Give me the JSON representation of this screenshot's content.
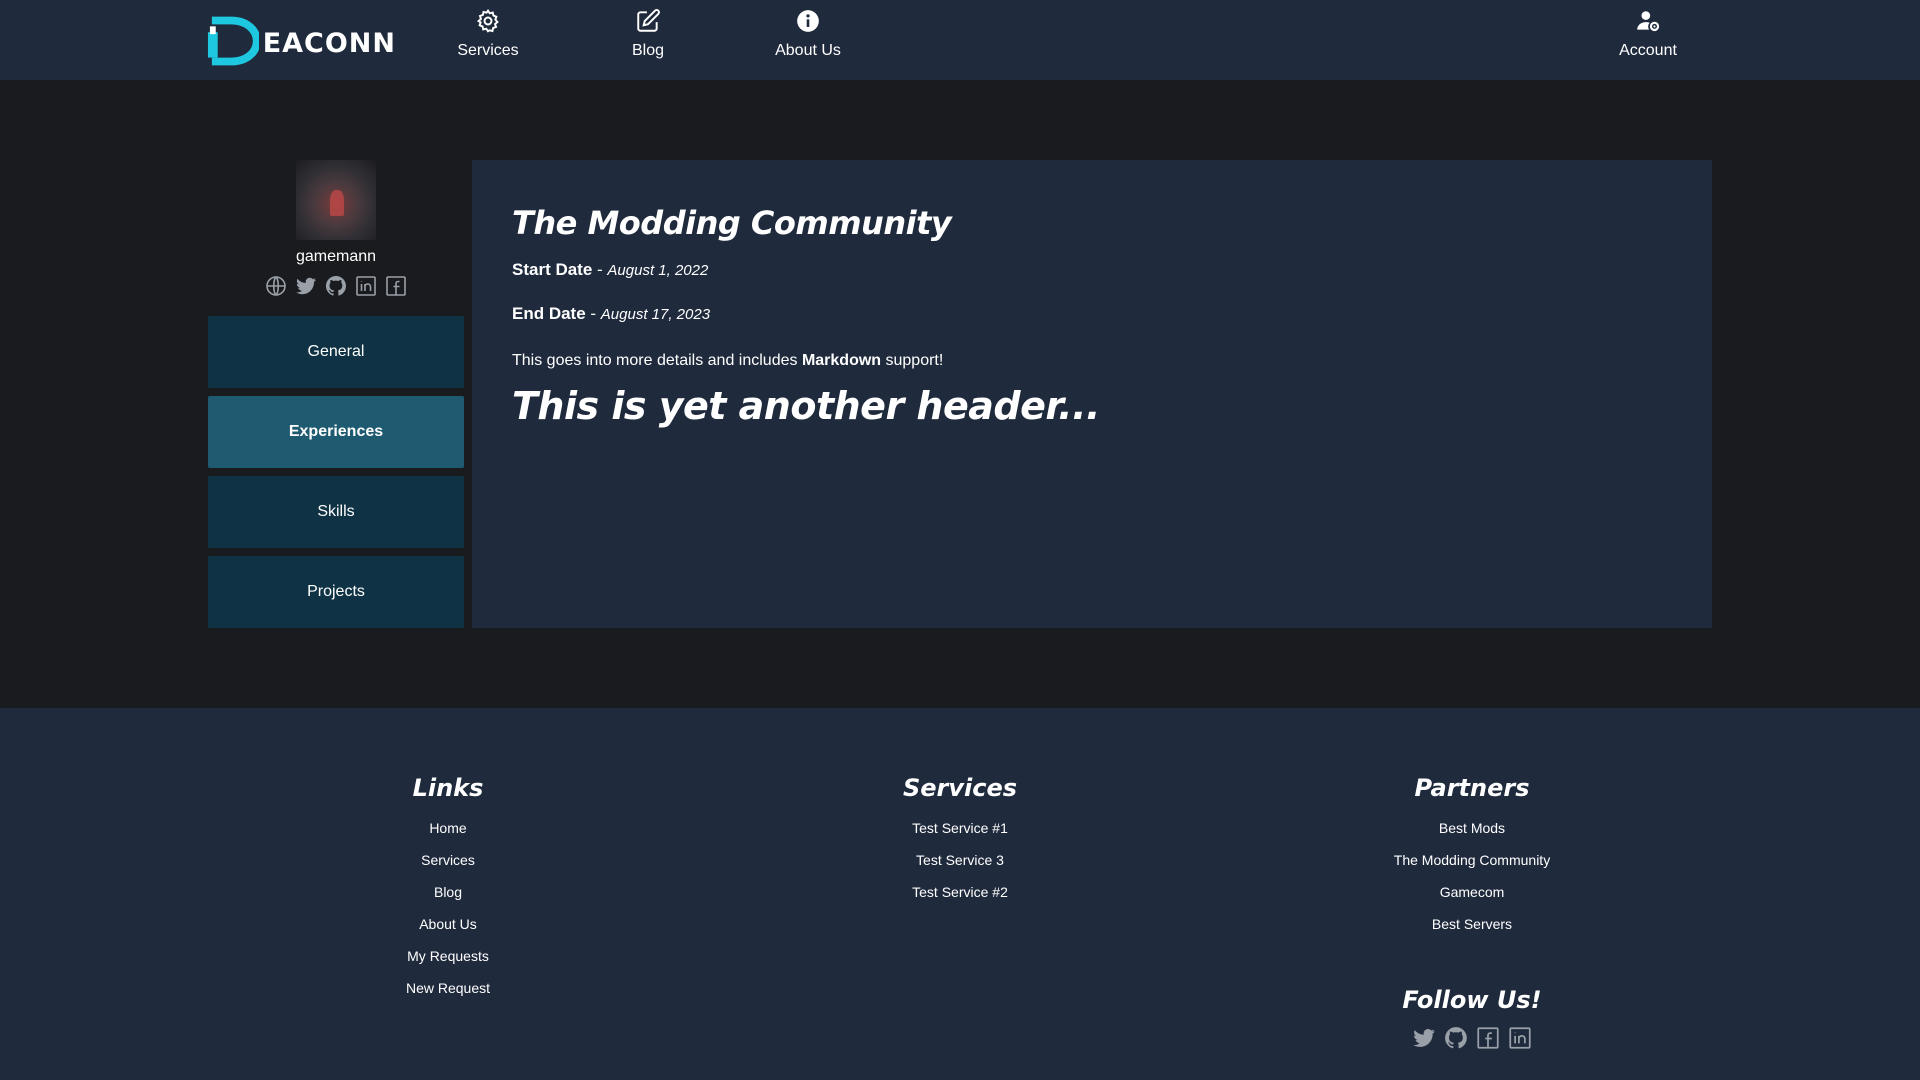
{
  "brand": {
    "name": "EACONN"
  },
  "nav": {
    "items": [
      {
        "label": "Services",
        "icon": "gear-icon"
      },
      {
        "label": "Blog",
        "icon": "edit-icon"
      },
      {
        "label": "About Us",
        "icon": "info-icon"
      }
    ],
    "account": {
      "label": "Account",
      "icon": "user-cog-icon"
    }
  },
  "profile": {
    "username": "gamemann",
    "socials": [
      "globe-icon",
      "twitter-icon",
      "github-icon",
      "linkedin-icon",
      "facebook-icon"
    ]
  },
  "tabs": [
    {
      "label": "General",
      "active": false
    },
    {
      "label": "Experiences",
      "active": true
    },
    {
      "label": "Skills",
      "active": false
    },
    {
      "label": "Projects",
      "active": false
    }
  ],
  "experience": {
    "title": "The Modding Community",
    "start_label": "Start Date",
    "start_sep": " - ",
    "start_value": "August 1, 2022",
    "end_label": "End Date",
    "end_sep": " - ",
    "end_value": "August 17, 2023",
    "desc_before": "This goes into more details and includes ",
    "desc_bold": "Markdown",
    "desc_after": " support!",
    "header": "This is yet another header..."
  },
  "footer": {
    "links": {
      "title": "Links",
      "items": [
        "Home",
        "Services",
        "Blog",
        "About Us",
        "My Requests",
        "New Request"
      ]
    },
    "services": {
      "title": "Services",
      "items": [
        "Test Service #1",
        "Test Service 3",
        "Test Service #2"
      ]
    },
    "partners": {
      "title": "Partners",
      "items": [
        "Best Mods",
        "The Modding Community",
        "Gamecom",
        "Best Servers"
      ]
    },
    "follow": {
      "title": "Follow Us!",
      "socials": [
        "twitter-icon",
        "github-icon",
        "facebook-icon",
        "linkedin-icon"
      ]
    }
  },
  "colors": {
    "nav_bg": "#1f2a3c",
    "page_bg": "#1a1b1f",
    "tab_bg": "#0f3244",
    "tab_active_bg": "#1e5a70",
    "logo_accent": "#1ec8e0",
    "social_icon": "#9aa0a8"
  }
}
